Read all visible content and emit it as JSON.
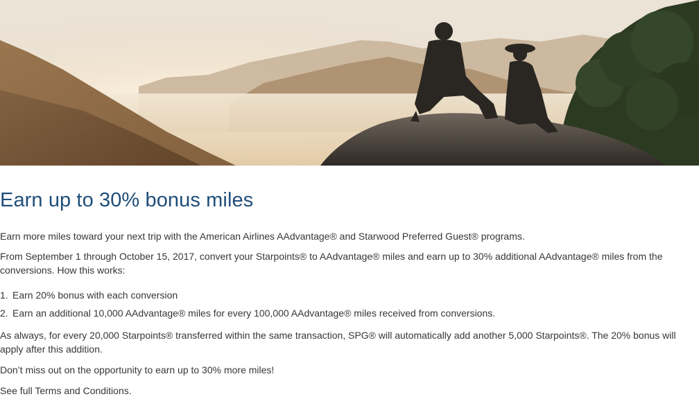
{
  "hero": {
    "image_alt": "Two hikers sitting on a rock overlooking a bay at sunset"
  },
  "headline": "Earn up to 30% bonus miles",
  "intro": "Earn more miles toward your next trip with the American Airlines AAdvantage® and Starwood Preferred Guest® programs.",
  "details": "From September 1 through October 15, 2017, convert your Starpoints® to AAdvantage® miles and earn up to 30% additional AAdvantage® miles from the conversions. How this works:",
  "steps": [
    {
      "number": "1.",
      "text": "Earn 20% bonus with each conversion"
    },
    {
      "number": "2.",
      "text": "Earn an additional 10,000 AAdvantage® miles for every 100,000 AAdvantage® miles received from conversions."
    }
  ],
  "note": "As always, for every 20,000 Starpoints® transferred within the same transaction, SPG® will automatically add another 5,000 Starpoints®. The 20% bonus will apply after this addition.",
  "cta": "Don’t miss out on the opportunity to earn up to 30% more miles!",
  "terms_link": "See full Terms and Conditions."
}
